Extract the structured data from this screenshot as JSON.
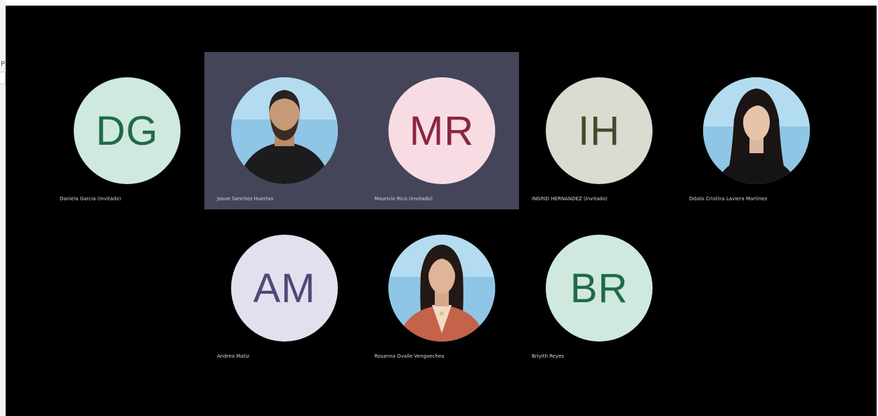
{
  "left_strip": {
    "stub_text": "P"
  },
  "participants": [
    {
      "name": "Daniela Garcia (Invitado)",
      "initials": "DG",
      "bg": "#cfe9df",
      "fg": "#1f6b46",
      "photo": null,
      "highlighted": false
    },
    {
      "name": "Josue Sanchez Huertas",
      "initials": "",
      "bg": "#8fc6e6",
      "fg": "#000000",
      "photo": "man-beard",
      "highlighted": true
    },
    {
      "name": "Mauricio Rico (Invitado)",
      "initials": "MR",
      "bg": "#f8dce4",
      "fg": "#8b2442",
      "photo": null,
      "highlighted": true
    },
    {
      "name": "INGRID HERNANDEZ (Invitado)",
      "initials": "IH",
      "bg": "#d9dcd1",
      "fg": "#454a2e",
      "photo": null,
      "highlighted": false
    },
    {
      "name": "Odalis Cristina Laviera Martinez",
      "initials": "",
      "bg": "#8fc6e6",
      "fg": "#000000",
      "photo": "woman-dark-hair",
      "highlighted": false
    },
    {
      "name": "Andrea Matiz",
      "initials": "AM",
      "bg": "#e2e0ee",
      "fg": "#4d4a78",
      "photo": null,
      "highlighted": false
    },
    {
      "name": "Rosanna Ovalle Vengoechea",
      "initials": "",
      "bg": "#8fc6e6",
      "fg": "#000000",
      "photo": "woman-red-jacket",
      "highlighted": false
    },
    {
      "name": "Briyith Reyes",
      "initials": "BR",
      "bg": "#cfe9df",
      "fg": "#1f6b46",
      "photo": null,
      "highlighted": false
    }
  ]
}
